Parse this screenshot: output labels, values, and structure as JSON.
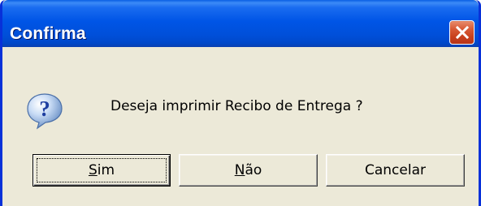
{
  "dialog": {
    "title": "Confirma",
    "message": "Deseja imprimir Recibo de Entrega ?",
    "icon": "question-icon",
    "close_icon": "close-icon",
    "buttons": {
      "yes": {
        "accel": "S",
        "rest": "im"
      },
      "no": {
        "accel": "N",
        "rest": "ão"
      },
      "cancel": {
        "label": "Cancelar"
      }
    }
  },
  "colors": {
    "titlebar": "#0055e6",
    "frame": "#0831d9",
    "face": "#ece9d8",
    "close": "#d85a36"
  }
}
